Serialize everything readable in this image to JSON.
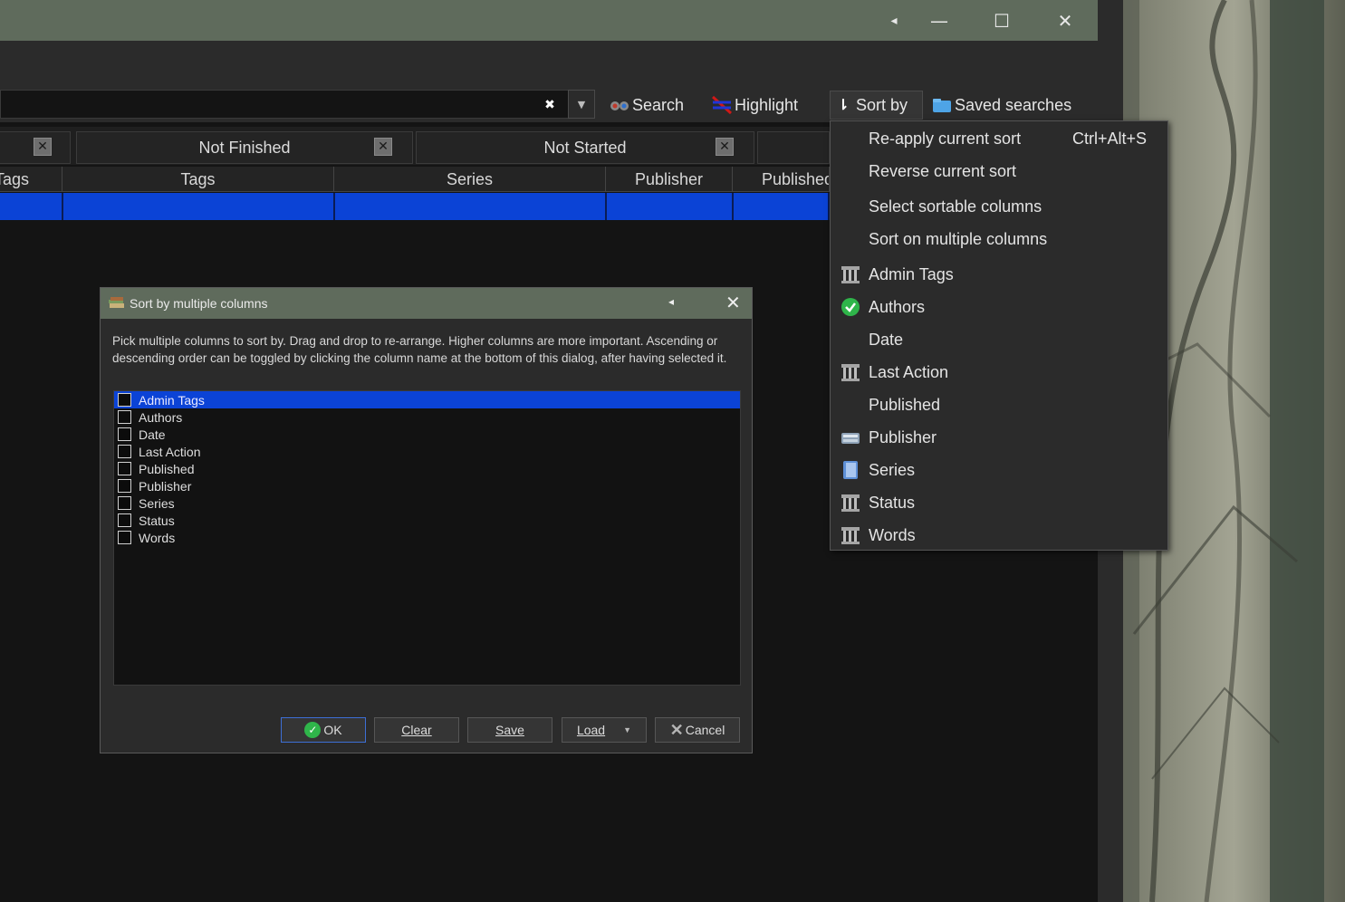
{
  "window": {
    "controls": {
      "back": "◂",
      "minimize": "—",
      "maximize": "☐",
      "close": "✕"
    }
  },
  "toolbar": {
    "search_value": "",
    "search_label": "Search",
    "highlight_label": "Highlight",
    "sort_by_label": "Sort by",
    "saved_searches_label": "Saved searches"
  },
  "vl_tabs": [
    {
      "label": ""
    },
    {
      "label": "Not Finished"
    },
    {
      "label": "Not Started"
    },
    {
      "label": ""
    }
  ],
  "columns": [
    "Tags",
    "Tags",
    "Series",
    "Publisher",
    "Published"
  ],
  "sort_menu": {
    "items": [
      {
        "label": "Re-apply current sort",
        "shortcut": "Ctrl+Alt+S",
        "icon": ""
      },
      {
        "label": "Reverse current sort",
        "shortcut": "",
        "icon": ""
      },
      {
        "label": "Select sortable columns",
        "shortcut": "",
        "icon": ""
      },
      {
        "label": "Sort on multiple columns",
        "shortcut": "",
        "icon": ""
      },
      {
        "label": "Admin Tags",
        "shortcut": "",
        "icon": "column-icon"
      },
      {
        "label": "Authors",
        "shortcut": "",
        "icon": "checkmark-icon"
      },
      {
        "label": "Date",
        "shortcut": "",
        "icon": ""
      },
      {
        "label": "Last Action",
        "shortcut": "",
        "icon": "column-icon"
      },
      {
        "label": "Published",
        "shortcut": "",
        "icon": ""
      },
      {
        "label": "Publisher",
        "shortcut": "",
        "icon": "publisher-icon"
      },
      {
        "label": "Series",
        "shortcut": "",
        "icon": "series-icon"
      },
      {
        "label": "Status",
        "shortcut": "",
        "icon": "column-icon"
      },
      {
        "label": "Words",
        "shortcut": "",
        "icon": "column-icon"
      }
    ]
  },
  "dialog": {
    "title": "Sort by multiple columns",
    "description": "Pick multiple columns to sort by. Drag and drop to re-arrange. Higher columns are more important. Ascending or descending order can be toggled by clicking the column name at the bottom of this dialog, after having selected it.",
    "columns": [
      {
        "label": "Admin Tags",
        "checked": false,
        "selected": true
      },
      {
        "label": "Authors",
        "checked": false,
        "selected": false
      },
      {
        "label": "Date",
        "checked": false,
        "selected": false
      },
      {
        "label": "Last Action",
        "checked": false,
        "selected": false
      },
      {
        "label": "Published",
        "checked": false,
        "selected": false
      },
      {
        "label": "Publisher",
        "checked": false,
        "selected": false
      },
      {
        "label": "Series",
        "checked": false,
        "selected": false
      },
      {
        "label": "Status",
        "checked": false,
        "selected": false
      },
      {
        "label": "Words",
        "checked": false,
        "selected": false
      }
    ],
    "buttons": {
      "ok": "OK",
      "clear": "Clear",
      "save": "Save",
      "load": "Load",
      "cancel": "Cancel"
    }
  },
  "colors": {
    "titlebar": "#5f6b5c",
    "selection": "#0b43d6",
    "accent_green": "#2fb54a"
  }
}
